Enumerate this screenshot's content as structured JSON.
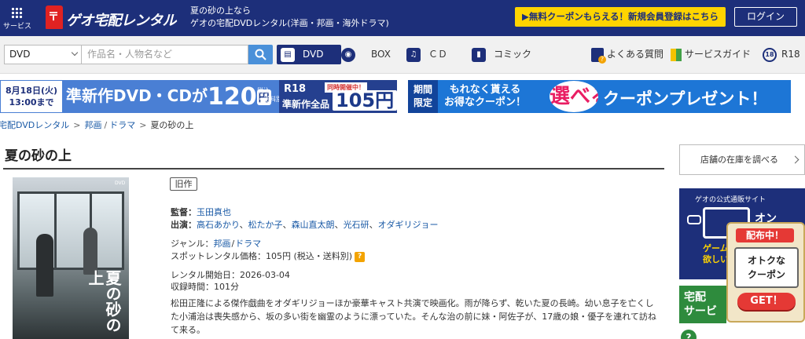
{
  "header": {
    "services_label": "サービス",
    "logo_text": "ゲオ宅配レンタル",
    "tagline_line1": "夏の砂の上なら",
    "tagline_line2": "ゲオの宅配DVDレンタル(洋画・邦画・海外ドラマ)",
    "promo_button": "▶無料クーポンもらえる！新規会員登録はこちら",
    "login_button": "ログイン",
    "brand_color": "#1d2f7a",
    "promo_color": "#ffd400"
  },
  "search": {
    "category_selected": "DVD",
    "placeholder": "作品名・人物名など"
  },
  "nav": {
    "tabs": [
      {
        "label": "DVD",
        "icon": "film-icon"
      },
      {
        "label": "",
        "icon": "bluray-disc-icon"
      },
      {
        "label": "BOX",
        "icon": "box-icon"
      },
      {
        "label": "ＣＤ",
        "icon": "music-note-icon"
      },
      {
        "label": "コミック",
        "icon": "book-icon"
      }
    ],
    "faq": "よくある質問",
    "guide": "サービスガイド",
    "r18": "R18",
    "r18_icon_text": "18"
  },
  "banners": {
    "left": {
      "date_line1": "8月18日(火)",
      "date_line2": "13:00まで",
      "main_prefix": "準新作DVD・CDが",
      "price": "120",
      "yen": "円",
      "tax_note_1": "税込",
      "tax_note_2": "・送料別",
      "r18_label": "R18",
      "r18_sub": "準新作全品",
      "concurrent": "同時開催中！",
      "r18_price": "105円"
    },
    "right": {
      "limited_1": "期間",
      "limited_2": "限定",
      "text_line1": "もれなく貰える",
      "text_line2": "お得なクーポン！",
      "choose": "選べる",
      "main": "クーポンプレゼント！"
    }
  },
  "breadcrumb": {
    "items": [
      "宅配DVDレンタル",
      "邦画",
      "ドラマ"
    ],
    "current": "夏の砂の上",
    "sep_arrow": ">",
    "sep_slash": "/"
  },
  "product": {
    "title": "夏の砂の上",
    "cover_title": "夏の砂の上",
    "cover_dvd": "DVD",
    "badge": "旧作",
    "director_label": "監督：",
    "director": "玉田真也",
    "cast_label": "出演：",
    "cast": [
      "高石あかり",
      "松たか子",
      "森山直太朗",
      "光石研",
      "オダギリジョー"
    ],
    "cast_sep": "、",
    "genre_label": "ジャンル：",
    "genre_main": "邦画",
    "genre_sep": "/",
    "genre_sub": "ドラマ",
    "price_label": "スポットレンタル価格：",
    "price": "105円 (税込・送料別)",
    "help_glyph": "?",
    "start_label": "レンタル開始日：",
    "start_date": "2026-03-04",
    "runtime_label": "収録時間：",
    "runtime": "101分",
    "description": "松田正隆による傑作戯曲をオダギリジョーほか豪華キャスト共演で映画化。雨が降らず、乾いた夏の長崎。幼い息子を亡くした小浦治は喪失感から、坂の多い街を幽霊のように漂っていた。そんな治の前に妹・阿佐子が、17歳の娘・優子を連れて訪ねて来る。"
  },
  "sidebar": {
    "stock_button": "店舗の在庫を調べる",
    "geo_ad_top": "ゲオの公式通販サイト",
    "geo_ad_on": "オン",
    "geo_ad_line1": "ゲーム",
    "geo_ad_line2": "欲しい商",
    "coupon_top": "配布中！",
    "coupon_mid1": "オトクな",
    "coupon_mid2": "クーポン",
    "coupon_get": "GET！",
    "green_ad_1": "宅配",
    "green_ad_2": "サービ",
    "help_glyph": "?"
  }
}
